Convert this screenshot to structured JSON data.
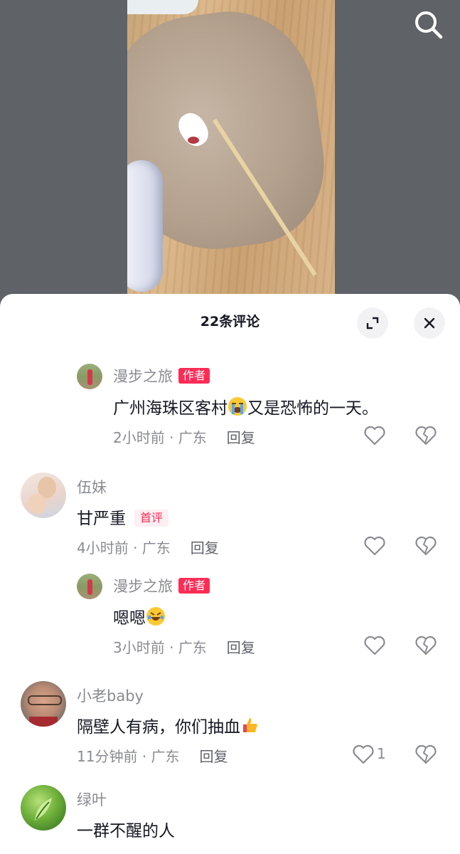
{
  "sheet": {
    "title": "22条评论"
  },
  "icons": {
    "search": "search-icon",
    "expand": "expand-icon",
    "close": "close-icon",
    "like": "heart-icon",
    "dislike": "broken-heart-icon"
  },
  "colors": {
    "accent": "#fe2c55",
    "meta": "#8a8b91",
    "text": "#161823"
  },
  "comments": [
    {
      "name": "漫步之旅",
      "tag": "作者",
      "text_before": "广州海珠区客村",
      "emoji": "loudly-crying-face",
      "text_after": "又是恐怖的一天。",
      "time": "2小时前 · 广东",
      "reply": "回复"
    },
    {
      "name": "伍妹",
      "tag": "首评",
      "text": "甘严重",
      "time": "4小时前 · 广东",
      "reply": "回复"
    },
    {
      "name": "漫步之旅",
      "tag": "作者",
      "text": "嗯嗯",
      "emoji": "rolling-on-floor-laughing",
      "time": "3小时前 · 广东",
      "reply": "回复"
    },
    {
      "name": "小老baby",
      "text": "隔壁人有病，你们抽血",
      "emoji": "thumbs-up",
      "time": "11分钟前 · 广东",
      "reply": "回复",
      "likes": "1"
    },
    {
      "name": "绿叶",
      "text": "一群不醒的人"
    }
  ]
}
